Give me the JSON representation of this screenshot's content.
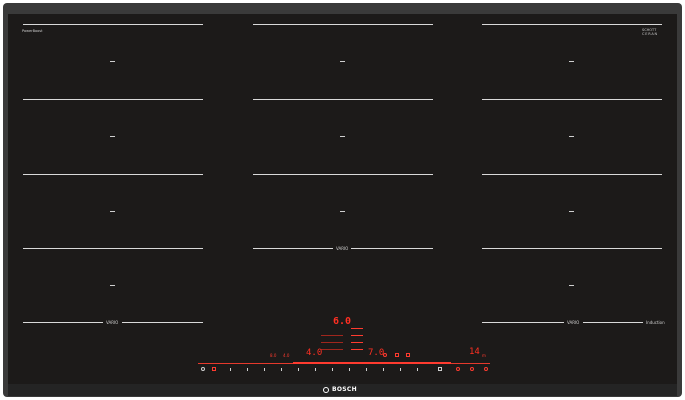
{
  "brand": {
    "wordmark": "BOSCH",
    "logo_icon": "bosch-circle-logo-icon"
  },
  "top_left_label": "PowerBoost",
  "top_right_label": {
    "line1": "SCHOTT",
    "line2": "CERAN",
    "line3": ""
  },
  "zone_vario_label": "VARIO",
  "bottom_right_label": "Induction",
  "displays": {
    "top_center": "6.0",
    "center_left": "4.0",
    "center_right": "7.0",
    "right_value": "14",
    "right_unit": "m"
  },
  "small_labels": {
    "left_a": "8.0",
    "left_b": "4.0"
  },
  "colors": {
    "glass": "#1c1a19",
    "frame": "#3a3a3a",
    "zone_lines": "#d9d9d9",
    "display_red": "#ff3b2f"
  },
  "icons": {
    "power": "power-icon",
    "boost": "boost-icon",
    "timer": "timer-icon",
    "lock": "lock-icon",
    "settings": "settings-icon"
  }
}
